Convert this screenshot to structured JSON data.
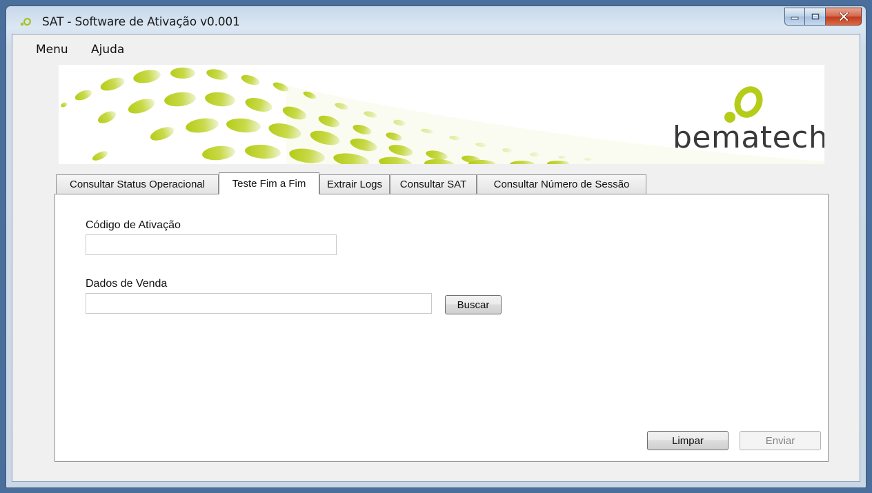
{
  "window": {
    "title": "SAT - Software de Ativação v0.001",
    "controls": [
      "minimize-icon",
      "maximize-icon",
      "close-icon"
    ]
  },
  "menu": {
    "items": [
      {
        "label": "Menu"
      },
      {
        "label": "Ajuda"
      }
    ]
  },
  "banner": {
    "brand": "bematech",
    "colors": {
      "accent": "#b5cc18",
      "text": "#3a3a3a"
    }
  },
  "tabs": [
    {
      "label": "Consultar Status Operacional",
      "active": false
    },
    {
      "label": "Teste Fim a Fim",
      "active": true
    },
    {
      "label": "Extrair Logs",
      "active": false
    },
    {
      "label": "Consultar SAT",
      "active": false
    },
    {
      "label": "Consultar Número de Sessão",
      "active": false
    }
  ],
  "form": {
    "codigo_label": "Código de Ativação",
    "codigo_value": "",
    "dados_label": "Dados de Venda",
    "dados_value": "",
    "buscar_label": "Buscar",
    "limpar_label": "Limpar",
    "enviar_label": "Enviar",
    "enviar_enabled": false
  }
}
